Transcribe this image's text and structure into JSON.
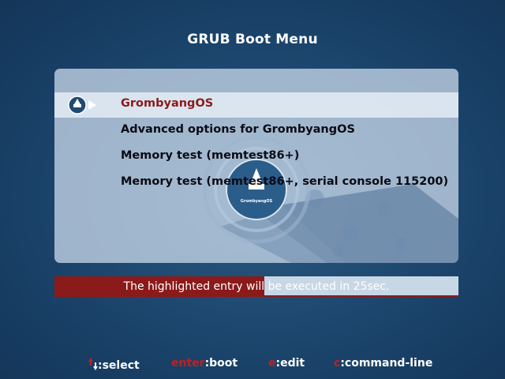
{
  "header": {
    "title": "GRUB Boot Menu"
  },
  "menu": {
    "logo_text": "GrombyangOS",
    "entries": [
      {
        "label": "GrombyangOS",
        "selected": true
      },
      {
        "label": "Advanced options for GrombyangOS",
        "selected": false
      },
      {
        "label": "Memory test (memtest86+)",
        "selected": false
      },
      {
        "label": "Memory test (memtest86+, serial console 115200)",
        "selected": false
      }
    ]
  },
  "timeout": {
    "text": "The highlighted entry will be executed in 25sec.",
    "progress": 0.52
  },
  "help": {
    "arrows_icon": "up-down-arrows-icon",
    "select_label": ":select",
    "enter_key": "enter",
    "boot_label": ":boot",
    "edit_key": "e",
    "edit_label": ":edit",
    "cmd_key": "c",
    "cmd_label": ":command-line"
  },
  "colors": {
    "background": "#1f4a72",
    "selected_text": "#8b1a1a",
    "key_highlight": "#c02020",
    "progress_fill": "#8b1a1a"
  }
}
